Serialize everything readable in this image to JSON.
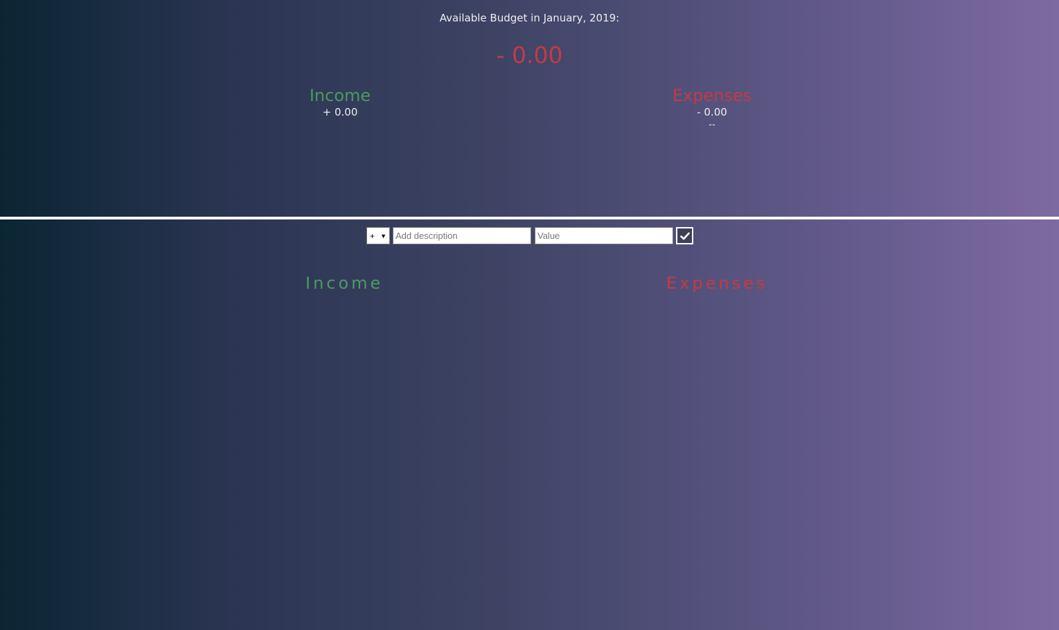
{
  "header": {
    "title": "Available Budget in January, 2019:",
    "budget": "- 0.00"
  },
  "summary": {
    "income": {
      "label": "Income",
      "value": "+ 0.00"
    },
    "expenses": {
      "label": "Expenses",
      "value": "- 0.00",
      "percentage": "--"
    }
  },
  "add_form": {
    "type_value": "+",
    "description_placeholder": "Add description",
    "value_placeholder": "Value",
    "submit_icon": "checkmark-icon"
  },
  "lists": {
    "income_title": "Income",
    "expenses_title": "Expenses"
  },
  "colors": {
    "income": "#4a9a5f",
    "expenses": "#c23b44",
    "gradient_start": "#0b2533",
    "gradient_end": "#7e6aa2"
  }
}
